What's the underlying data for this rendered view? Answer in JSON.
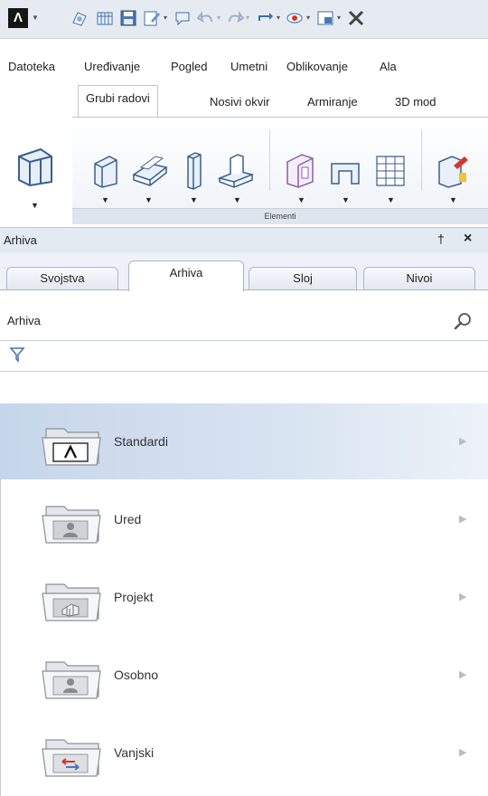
{
  "menu": [
    "Datoteka",
    "Uređivanje",
    "Pogled",
    "Umetni",
    "Oblikovanje",
    "Ala"
  ],
  "ribbon": {
    "tabs": [
      "Grubi radovi",
      "Nosivi okvir",
      "Armiranje",
      "3D mod"
    ],
    "active_tab": "Grubi radovi",
    "group_label": "Elementi"
  },
  "panel": {
    "title": "Arhiva",
    "pin_glyph": "†",
    "close_glyph": "×",
    "tabs": [
      "Svojstva",
      "Arhiva",
      "Sloj",
      "Nivoi"
    ],
    "active_tab": "Arhiva",
    "search_label": "Arhiva"
  },
  "archive_items": [
    {
      "label": "Standardi",
      "icon": "standard-folder-icon",
      "selected": true
    },
    {
      "label": "Ured",
      "icon": "office-folder-icon",
      "selected": false
    },
    {
      "label": "Projekt",
      "icon": "project-folder-icon",
      "selected": false
    },
    {
      "label": "Osobno",
      "icon": "personal-folder-icon",
      "selected": false
    },
    {
      "label": "Vanjski",
      "icon": "external-folder-icon",
      "selected": false
    }
  ],
  "colors": {
    "selection": "#c6d6ea",
    "panel_header": "#e4eaf2",
    "accent_red": "#d9342b"
  }
}
